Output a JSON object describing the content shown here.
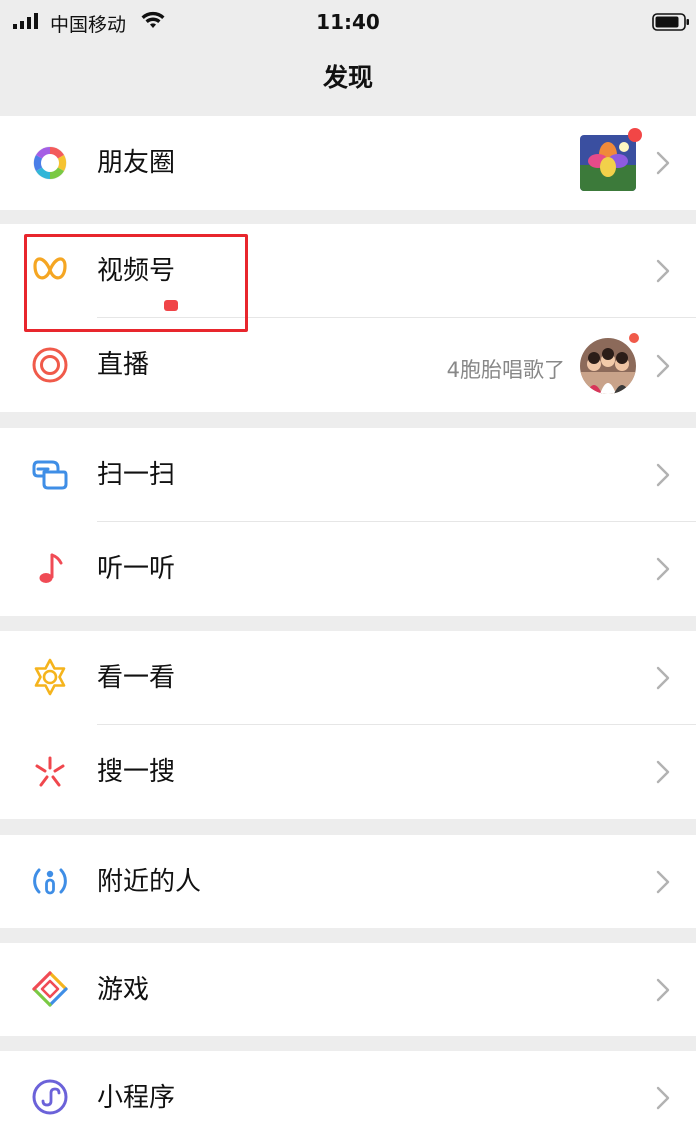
{
  "status_bar": {
    "carrier": "中国移动",
    "time": "11:40",
    "icons": [
      "signal-icon",
      "wifi-icon",
      "battery-icon"
    ]
  },
  "header": {
    "title": "发现"
  },
  "menu": {
    "moments": {
      "label": "朋友圈",
      "icon": "moments-camera-icon"
    },
    "channels": {
      "label": "视频号",
      "icon": "channels-icon"
    },
    "live": {
      "label": "直播",
      "icon": "live-icon",
      "subtitle": "4胞胎唱歌了"
    },
    "scan": {
      "label": "扫一扫",
      "icon": "scan-icon"
    },
    "listen": {
      "label": "听一听",
      "icon": "music-note-icon"
    },
    "look": {
      "label": "看一看",
      "icon": "look-icon"
    },
    "search": {
      "label": "搜一搜",
      "icon": "search-star-icon"
    },
    "nearby": {
      "label": "附近的人",
      "icon": "nearby-people-icon"
    },
    "games": {
      "label": "游戏",
      "icon": "games-icon"
    },
    "mini_programs": {
      "label": "小程序",
      "icon": "mini-program-icon"
    }
  },
  "colors": {
    "background": "#ededed",
    "badge_red": "#f24646",
    "highlight_red": "#e8262d",
    "channels_orange": "#f5a623",
    "scan_blue": "#3f8ee6",
    "music_red": "#f04b55"
  }
}
